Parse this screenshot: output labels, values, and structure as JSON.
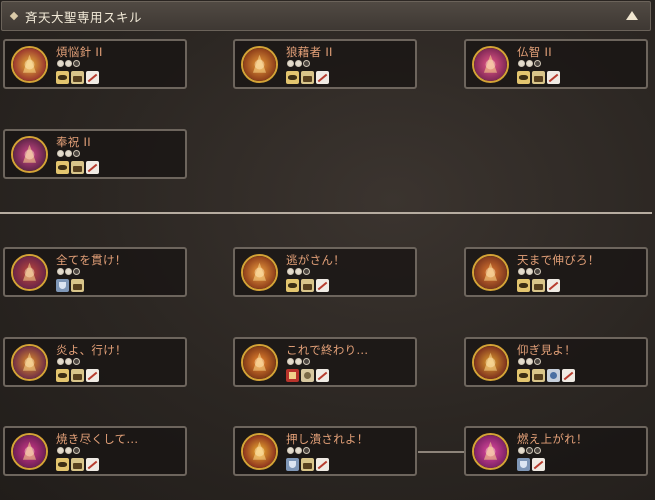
{
  "header": {
    "title": "斉天大聖専用スキル"
  },
  "skills": [
    {
      "name": "煩悩針 II",
      "cost": [
        1,
        1,
        0
      ],
      "tags": [
        "eye",
        "buff",
        "slash"
      ],
      "colors": [
        "#8a1c2a",
        "#e8b23a"
      ]
    },
    {
      "name": "狼藉者 II",
      "cost": [
        1,
        1,
        0
      ],
      "tags": [
        "eye",
        "buff",
        "slash"
      ],
      "colors": [
        "#7a2a12",
        "#e89a3a"
      ]
    },
    {
      "name": "仏智 II",
      "cost": [
        1,
        1,
        0
      ],
      "tags": [
        "eye",
        "buff",
        "slash"
      ],
      "colors": [
        "#6a1d4a",
        "#e85a8a"
      ]
    },
    {
      "name": "奉祝 II",
      "cost": [
        1,
        1,
        0
      ],
      "tags": [
        "eye",
        "buff",
        "slash"
      ],
      "colors": [
        "#4a1d3a",
        "#d04a8a"
      ]
    },
    {
      "name": "全てを貫け！",
      "cost": [
        1,
        1,
        0
      ],
      "tags": [
        "shield",
        "buff"
      ],
      "colors": [
        "#5a1d4a",
        "#c04a3a"
      ]
    },
    {
      "name": "逃がさん！",
      "cost": [
        1,
        1,
        0
      ],
      "tags": [
        "eye",
        "buff",
        "slash"
      ],
      "colors": [
        "#7a2a12",
        "#f0a040"
      ]
    },
    {
      "name": "天まで伸びろ！",
      "cost": [
        1,
        1,
        0
      ],
      "tags": [
        "eye",
        "buff",
        "slash"
      ],
      "colors": [
        "#6a2a1a",
        "#e07a30"
      ]
    },
    {
      "name": "炎よ、行け！",
      "cost": [
        1,
        1,
        0
      ],
      "tags": [
        "eye",
        "buff",
        "slash"
      ],
      "colors": [
        "#5a1a4a",
        "#e0902a"
      ]
    },
    {
      "name": "これで終わり...",
      "cost": [
        1,
        1,
        0
      ],
      "tags": [
        "gift",
        "person",
        "slash"
      ],
      "colors": [
        "#6a2a12",
        "#f08a30"
      ]
    },
    {
      "name": "仰ぎ見よ！",
      "cost": [
        1,
        1,
        0
      ],
      "tags": [
        "eye",
        "buff",
        "arrow",
        "slash"
      ],
      "colors": [
        "#6a1a1a",
        "#e0a030"
      ]
    },
    {
      "name": "焼き尽くして...",
      "cost": [
        1,
        1,
        0
      ],
      "tags": [
        "eye",
        "buff",
        "slash"
      ],
      "colors": [
        "#5a1a4a",
        "#d03a8a"
      ]
    },
    {
      "name": "押し潰されよ！",
      "cost": [
        1,
        1,
        0
      ],
      "tags": [
        "shield",
        "buff",
        "slash"
      ],
      "colors": [
        "#7a1a1a",
        "#f0b030"
      ]
    },
    {
      "name": "燃え上がれ！",
      "cost": [
        1,
        0,
        0
      ],
      "tags": [
        "shield",
        "slash"
      ],
      "colors": [
        "#6a1a5a",
        "#e04aa0"
      ]
    }
  ]
}
